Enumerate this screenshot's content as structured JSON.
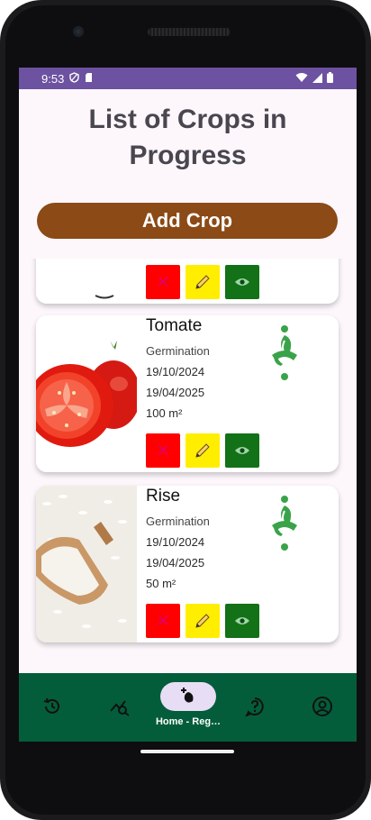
{
  "status_bar": {
    "time": "9:53"
  },
  "page": {
    "title_line1": "List of Crops in",
    "title_line2": "Progress"
  },
  "add_button": {
    "label": "Add Crop"
  },
  "crops": [
    {
      "name": "Tomate",
      "stage": "Germination",
      "start_date": "19/10/2024",
      "end_date": "19/04/2025",
      "area": "100 m²"
    },
    {
      "name": "Rise",
      "stage": "Germination",
      "start_date": "19/10/2024",
      "end_date": "19/04/2025",
      "area": "50 m²"
    }
  ],
  "bottom_nav": {
    "items": [
      {
        "icon": "history-icon"
      },
      {
        "icon": "analytics-icon"
      },
      {
        "icon": "add-seed-icon",
        "label": "Home - Reg…"
      },
      {
        "icon": "help-icon"
      },
      {
        "icon": "account-icon"
      }
    ]
  },
  "colors": {
    "status_bar": "#6c52a0",
    "add_button": "#8b4a16",
    "delete": "#ff0000",
    "edit": "#ffee00",
    "view": "#137117",
    "nav_bar": "#045d3a",
    "plant_icon": "#3aa34a"
  }
}
